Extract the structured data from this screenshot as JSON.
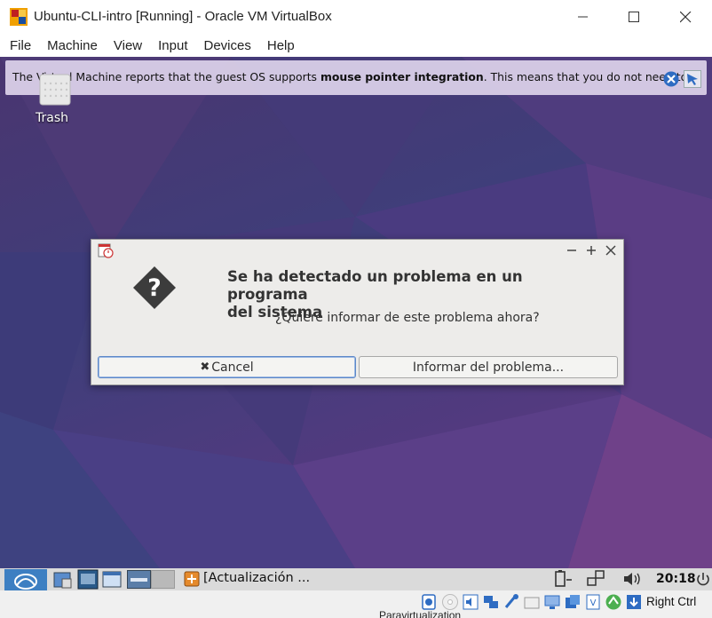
{
  "window": {
    "title": "Ubuntu-CLI-intro [Running] - Oracle VM VirtualBox",
    "minimize_icon": "minimize-icon",
    "maximize_icon": "maximize-icon",
    "close_icon": "close-icon"
  },
  "menu": {
    "items": [
      {
        "label": "File"
      },
      {
        "label": "Machine"
      },
      {
        "label": "View"
      },
      {
        "label": "Input"
      },
      {
        "label": "Devices"
      },
      {
        "label": "Help"
      }
    ]
  },
  "notification": {
    "text_before": "The Virtual Machine reports that the guest OS supports ",
    "text_bold": "mouse pointer integration",
    "text_after": ". This means that you do not need to"
  },
  "desktop": {
    "trash_label": "Trash"
  },
  "dialog": {
    "heading_line1": "Se ha detectado un problema en un programa",
    "heading_line2": "del sistema",
    "question": "¿Quiere informar de este problema ahora?",
    "cancel_label": "Cancel",
    "cancel_icon": "✖",
    "report_label": "Informar del problema..."
  },
  "taskbar": {
    "task_label": "[Actualización ...",
    "clock": "20:18"
  },
  "statusbar": {
    "host_key": "Right Ctrl",
    "partial_text": "Paravirtualization"
  },
  "colors": {
    "desktop_bg": "#4a3a78",
    "notif_bg": "#d7cde6",
    "dialog_bg": "#edecea",
    "accent": "#5d88c8"
  }
}
